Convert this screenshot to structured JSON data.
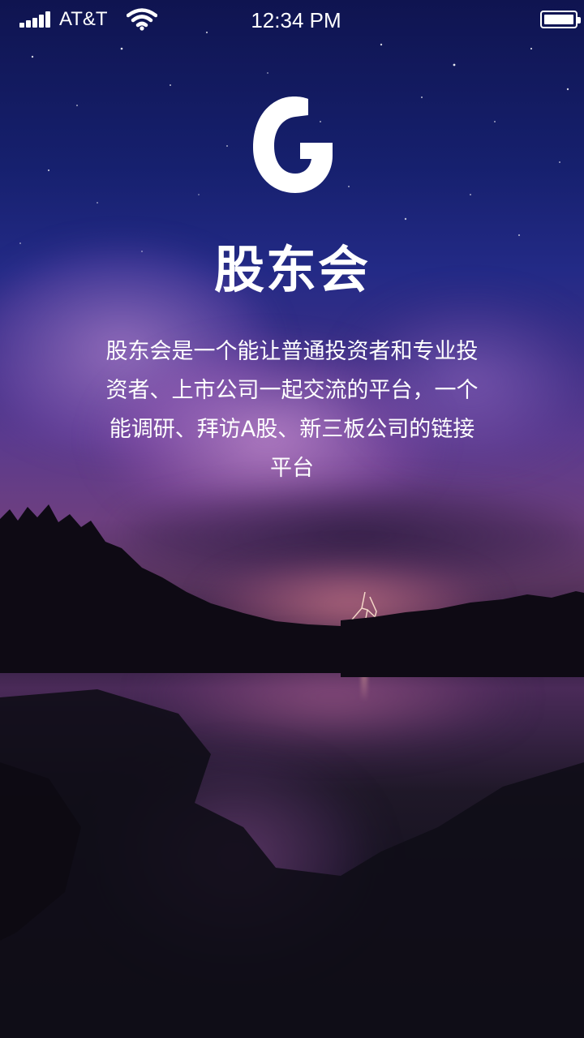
{
  "status_bar": {
    "carrier": "AT&T",
    "time": "12:34 PM",
    "signal_bars": 5,
    "battery_level": 1.0
  },
  "app": {
    "logo_icon": "g-letter-logo-icon",
    "title": "股东会",
    "description": "股东会是一个能让普通投资者和专业投资者、上市公司一起交流的平台，一个能调研、拜访A股、新三板公司的链接平台"
  },
  "colors": {
    "text": "#ffffff",
    "sky_top": "#0f1450",
    "sky_mid": "#3a2f86",
    "dusk": "#6d3f80",
    "ground": "#121019"
  }
}
